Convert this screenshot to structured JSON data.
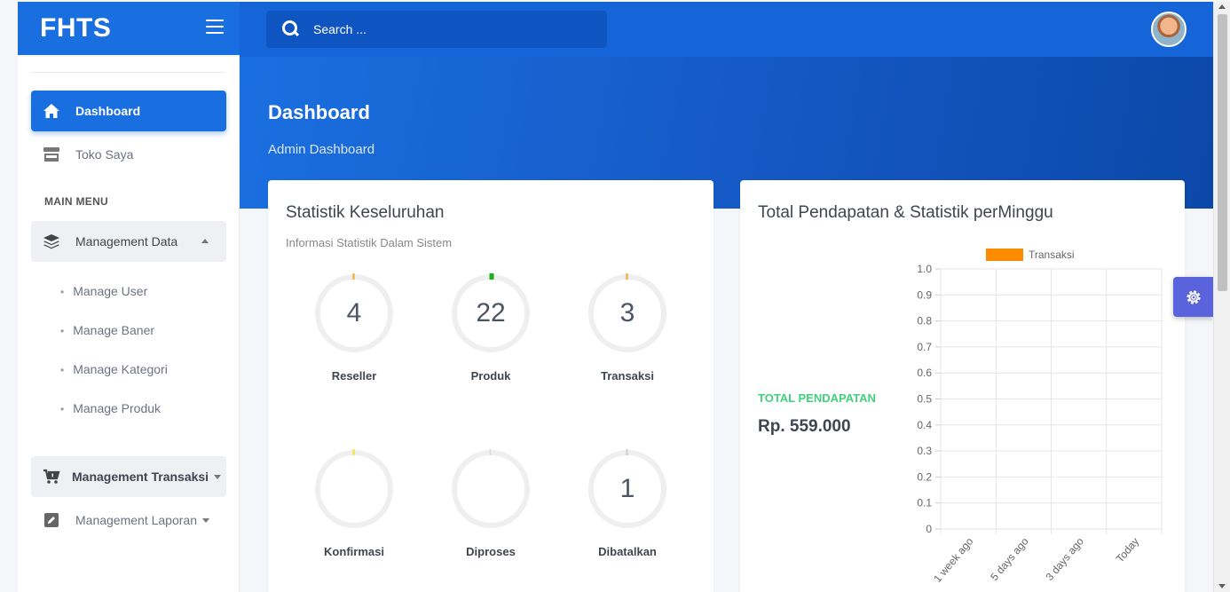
{
  "header": {
    "brand": "FHTS",
    "search_placeholder": "Search ..."
  },
  "sidebar": {
    "items": [
      {
        "label": "Dashboard",
        "icon": "home-icon"
      },
      {
        "label": "Toko Saya",
        "icon": "store-icon"
      }
    ],
    "section_label": "MAIN MENU",
    "management_data": {
      "label": "Management Data",
      "icon": "layers-icon"
    },
    "management_data_children": [
      "Manage User",
      "Manage Baner",
      "Manage Kategori",
      "Manage Produk"
    ],
    "management_transaksi": {
      "label": "Management Transaksi",
      "icon": "cart-icon"
    },
    "management_laporan": {
      "label": "Management Laporan",
      "icon": "edit-icon"
    }
  },
  "page": {
    "title": "Dashboard",
    "subtitle": "Admin Dashboard"
  },
  "stats_card": {
    "title": "Statistik Keseluruhan",
    "subtitle": "Informasi Statistik Dalam Sistem",
    "stats": [
      {
        "label": "Reseller",
        "value": "4",
        "color": "#f5a623"
      },
      {
        "label": "Produk",
        "value": "22",
        "color": "#1db01d"
      },
      {
        "label": "Transaksi",
        "value": "3",
        "color": "#f5a623"
      },
      {
        "label": "Konfirmasi",
        "value": "",
        "color": "#f5e41f"
      },
      {
        "label": "Diproses",
        "value": "",
        "color": "#dddddd"
      },
      {
        "label": "Dibatalkan",
        "value": "1",
        "color": "#cccccc"
      }
    ]
  },
  "income_card": {
    "title": "Total Pendapatan & Statistik perMinggu",
    "income_label": "TOTAL PENDAPATAN",
    "income_value": "Rp. 559.000"
  },
  "chart_data": {
    "type": "bar",
    "categories": [
      "1 week ago",
      "5 days ago",
      "3 days ago",
      "Today"
    ],
    "series": [
      {
        "name": "Transaksi",
        "values": [
          0,
          0,
          0,
          0
        ],
        "color": "#fb8c00"
      }
    ],
    "ylim": [
      0,
      1.0
    ],
    "yticks": [
      "0",
      "0.1",
      "0.2",
      "0.3",
      "0.4",
      "0.5",
      "0.6",
      "0.7",
      "0.8",
      "0.9",
      "1.0"
    ],
    "legend": "top",
    "grid": true
  }
}
